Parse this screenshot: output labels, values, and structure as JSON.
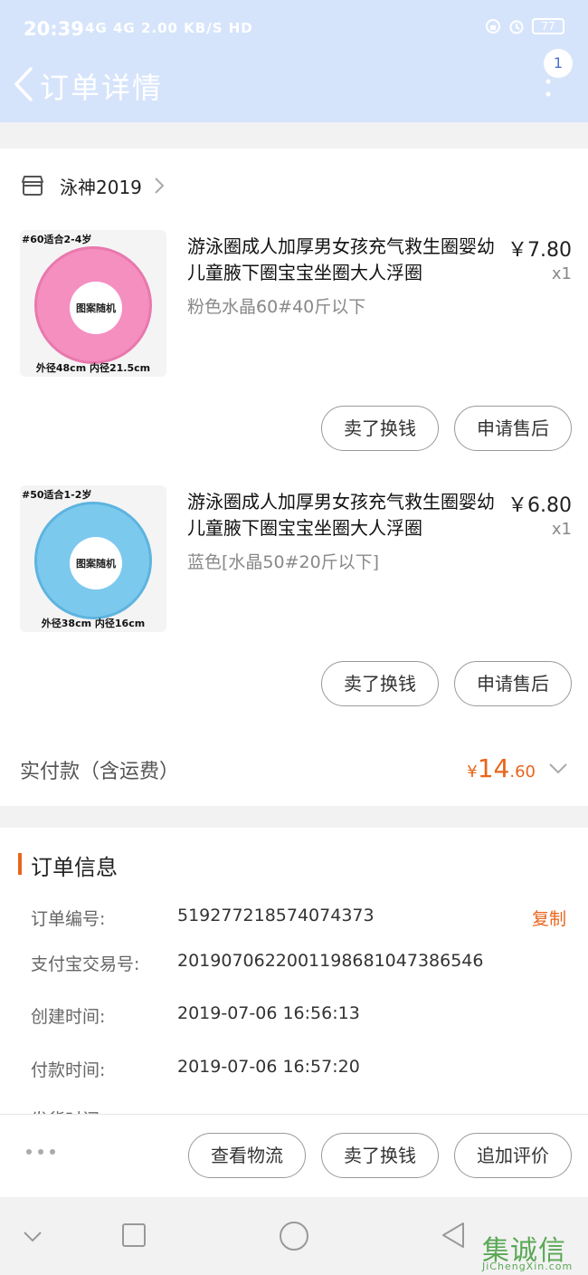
{
  "status": {
    "time": "20:39",
    "network": "4G 4G 2.00 KB/S HD",
    "battery": "77"
  },
  "nav": {
    "title": "订单详情",
    "badge": "1"
  },
  "shop": {
    "name": "泳神2019"
  },
  "items": [
    {
      "img_tag": "#60适合2-4岁",
      "img_center": "图案随机",
      "img_size": "外径48cm 内径21.5cm",
      "ring_color": "#f48fc0",
      "title": "游泳圈成人加厚男女孩充气救生圈婴幼儿童腋下圈宝宝坐圈大人浮圈",
      "price": "￥7.80",
      "qty": "x1",
      "spec": "粉色水晶60#40斤以下",
      "btn_sell": "卖了换钱",
      "btn_after": "申请售后"
    },
    {
      "img_tag": "#50适合1-2岁",
      "img_center": "图案随机",
      "img_size": "外径38cm 内径16cm",
      "ring_color": "#7cc9ee",
      "title": "游泳圈成人加厚男女孩充气救生圈婴幼儿童腋下圈宝宝坐圈大人浮圈",
      "price": "￥6.80",
      "qty": "x1",
      "spec": "蓝色[水晶50#20斤以下]",
      "btn_sell": "卖了换钱",
      "btn_after": "申请售后"
    }
  ],
  "total": {
    "label": "实付款（含运费）",
    "currency": "¥",
    "main": "14",
    "decimal": ".60"
  },
  "order_info": {
    "title": "订单信息",
    "copy": "复制",
    "rows": [
      {
        "label": "订单编号:",
        "value": "519277218574074373"
      },
      {
        "label": "支付宝交易号:",
        "value": "2019070622001198681047386546"
      },
      {
        "label": "创建时间:",
        "value": "2019-07-06 16:56:13"
      },
      {
        "label": "付款时间:",
        "value": "2019-07-06 16:57:20"
      },
      {
        "label": "发货时间:",
        "value": ""
      }
    ]
  },
  "actions": {
    "logistics": "查看物流",
    "sell": "卖了换钱",
    "review": "追加评价"
  },
  "watermark": {
    "cn": "集诚信",
    "en": "JiChengXin.com"
  },
  "colors": {
    "accent": "#e8651c",
    "header_bg": "#d6e4fb"
  }
}
